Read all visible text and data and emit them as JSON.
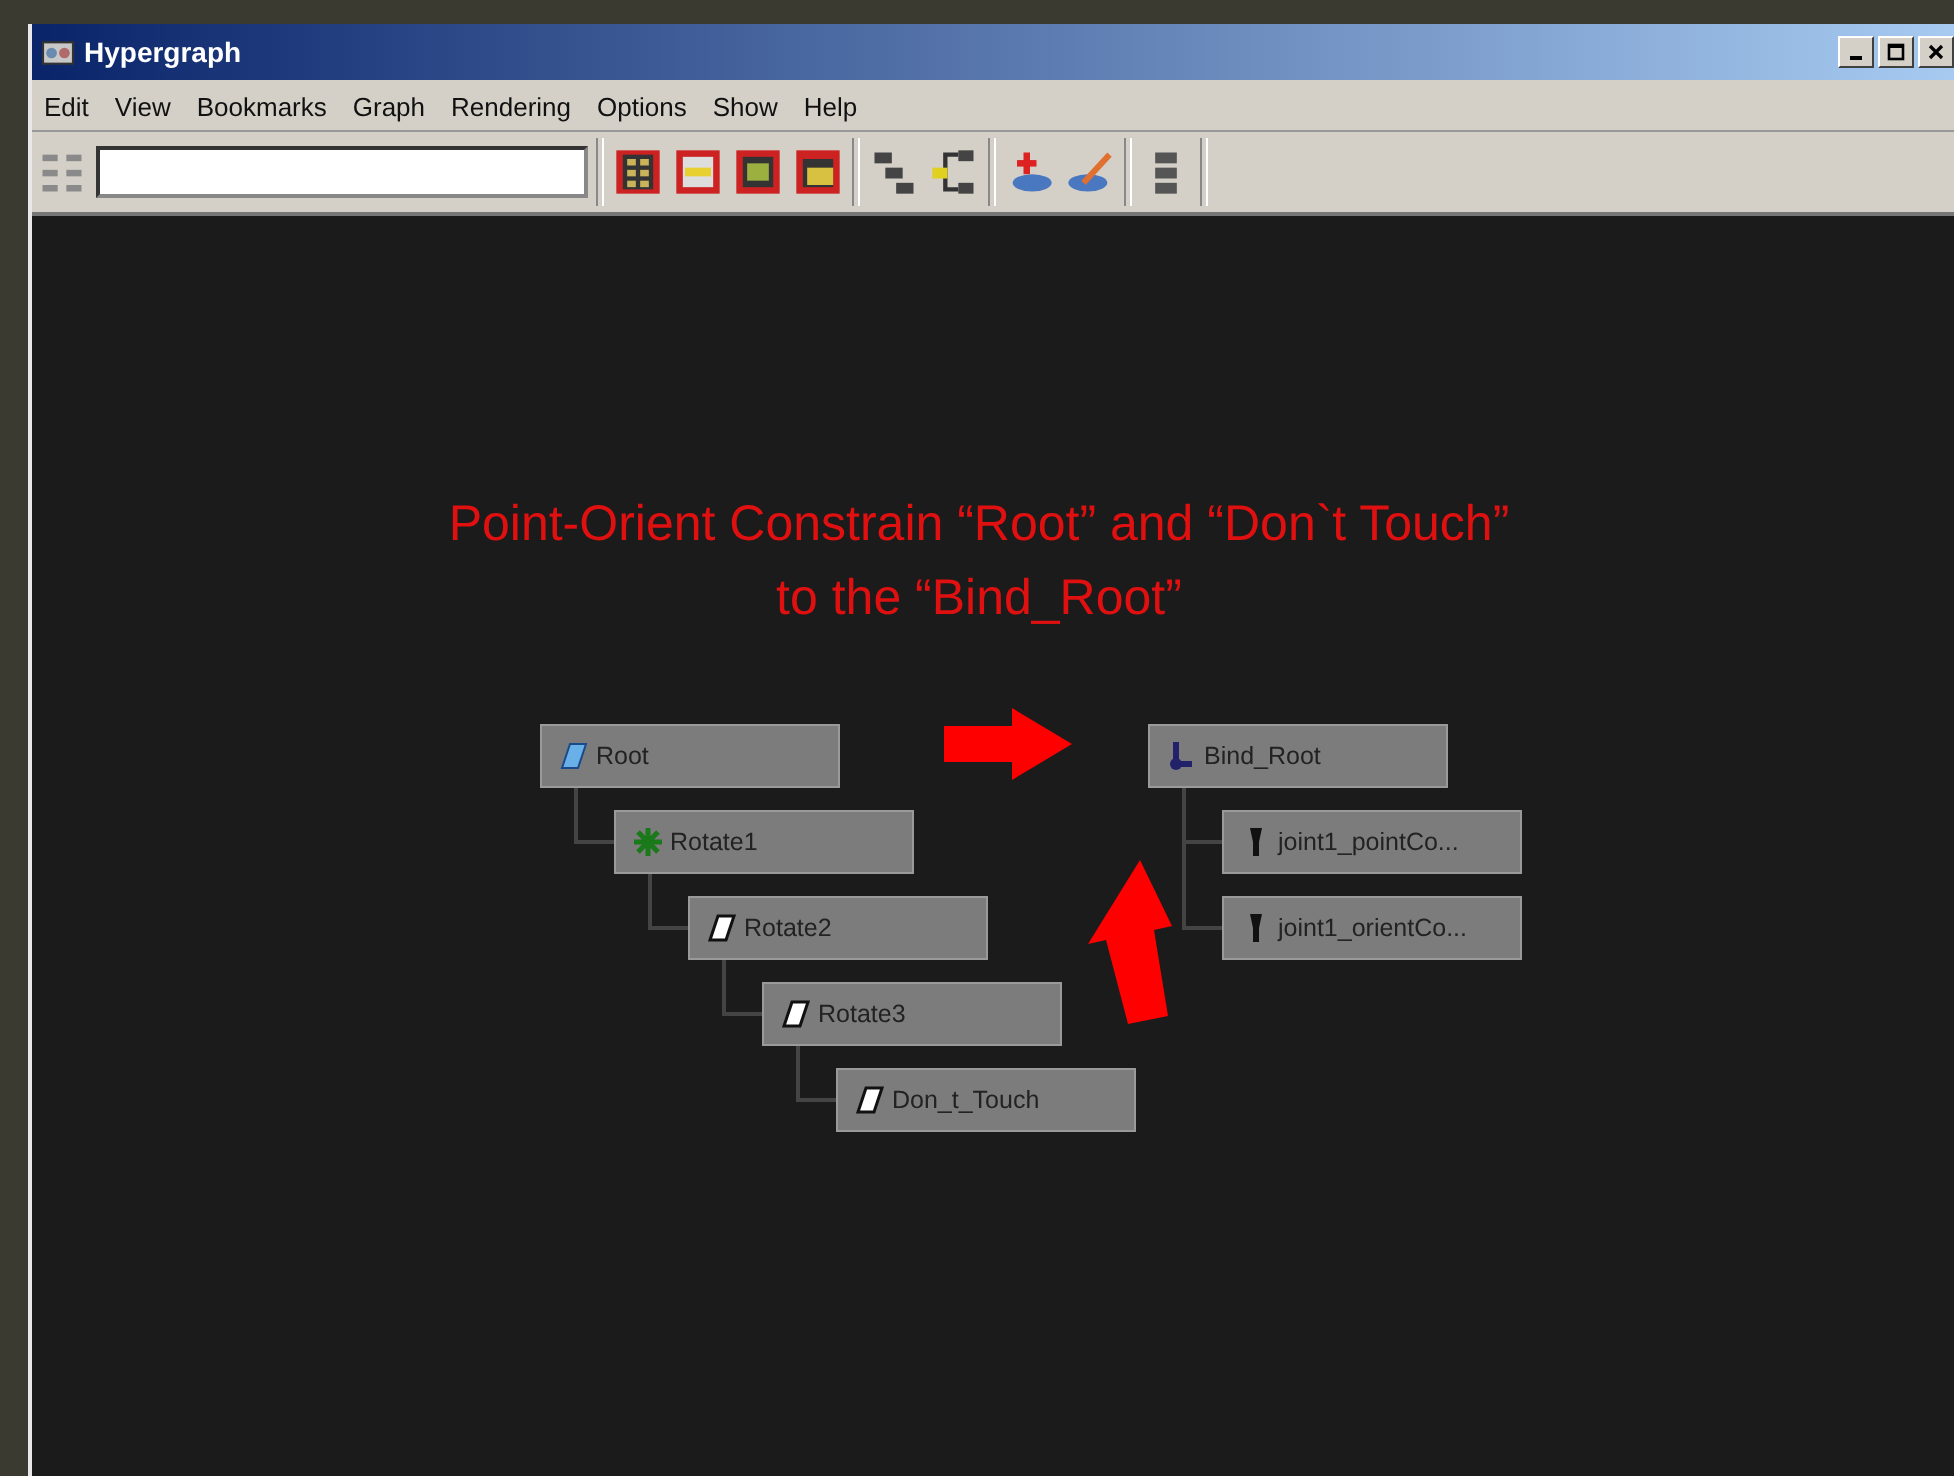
{
  "window": {
    "title": "Hypergraph"
  },
  "menu": [
    "Edit",
    "View",
    "Bookmarks",
    "Graph",
    "Rendering",
    "Options",
    "Show",
    "Help"
  ],
  "annotation": {
    "lines": [
      "Point-Orient Constrain “Root” and “Don`t Touch”",
      "to the “Bind_Root”"
    ]
  },
  "graph": [
    {
      "label": "Root",
      "kind": "transform",
      "children": [
        {
          "label": "Rotate1",
          "kind": "cluster",
          "children": [
            {
              "label": "Rotate2",
              "kind": "handle",
              "children": [
                {
                  "label": "Rotate3",
                  "kind": "handle",
                  "children": [
                    {
                      "label": "Don_t_Touch",
                      "kind": "handle"
                    }
                  ]
                }
              ]
            }
          ]
        }
      ]
    },
    {
      "label": "Bind_Root",
      "kind": "joint",
      "children": [
        {
          "label": "joint1_pointCo...",
          "kind": "constraint"
        },
        {
          "label": "joint1_orientCo...",
          "kind": "constraint"
        }
      ]
    }
  ]
}
